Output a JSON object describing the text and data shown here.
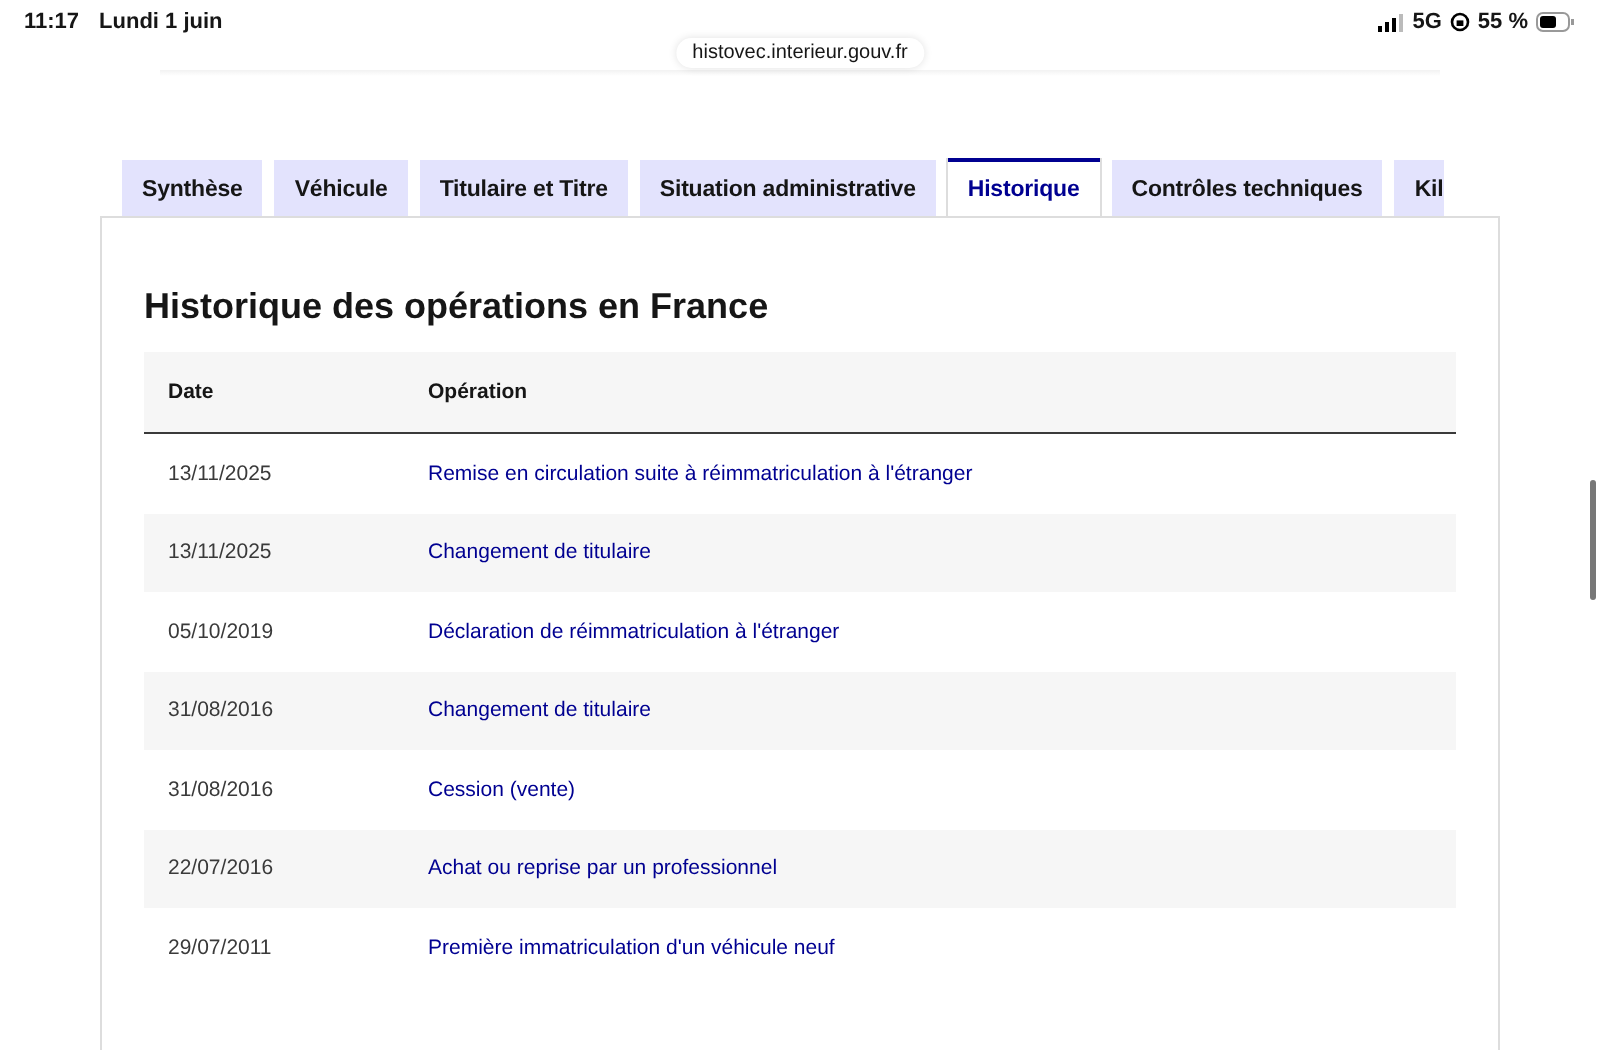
{
  "status_bar": {
    "time": "11:17",
    "date": "Lundi 1 juin",
    "network": "5G",
    "battery": "55 %"
  },
  "address_bar": {
    "url": "histovec.interieur.gouv.fr"
  },
  "tabs": [
    {
      "label": "Synthèse",
      "selected": false
    },
    {
      "label": "Véhicule",
      "selected": false
    },
    {
      "label": "Titulaire et Titre",
      "selected": false
    },
    {
      "label": "Situation administrative",
      "selected": false
    },
    {
      "label": "Historique",
      "selected": true
    },
    {
      "label": "Contrôles techniques",
      "selected": false
    },
    {
      "label": "Kil",
      "selected": false
    }
  ],
  "section": {
    "title": "Historique des opérations en France",
    "table": {
      "columns": [
        "Date",
        "Opération"
      ],
      "rows": [
        {
          "date": "13/11/2025",
          "operation": "Remise en circulation suite à réimmatriculation à l'étranger"
        },
        {
          "date": "13/11/2025",
          "operation": "Changement de titulaire"
        },
        {
          "date": "05/10/2019",
          "operation": "Déclaration de réimmatriculation à l'étranger"
        },
        {
          "date": "31/08/2016",
          "operation": "Changement de titulaire"
        },
        {
          "date": "31/08/2016",
          "operation": "Cession (vente)"
        },
        {
          "date": "22/07/2016",
          "operation": "Achat ou reprise par un professionnel"
        },
        {
          "date": "29/07/2011",
          "operation": "Première immatriculation d'un véhicule neuf"
        }
      ]
    }
  }
}
